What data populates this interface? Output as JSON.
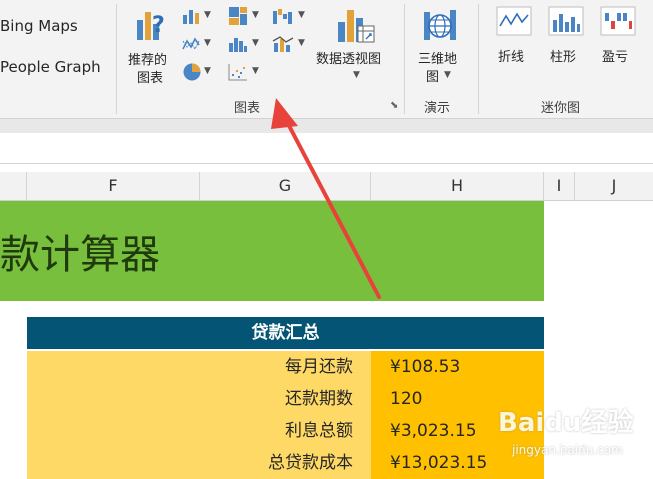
{
  "ribbon": {
    "addins": {
      "bing_maps": "Bing Maps",
      "people_graph": "People Graph"
    },
    "charts": {
      "recommended_line1": "推荐的",
      "recommended_line2": "图表",
      "pivot_chart": "数据透视图",
      "group_label": "图表"
    },
    "tours": {
      "map3d_line1": "三维地",
      "map3d_line2": "图",
      "group_label": "演示"
    },
    "sparklines": {
      "line": "折线",
      "column": "柱形",
      "winloss": "盈亏",
      "group_label": "迷你图"
    }
  },
  "sheet": {
    "columns": [
      "F",
      "G",
      "H",
      "I",
      "J"
    ],
    "title": "款计算器",
    "summary": {
      "header": "贷款汇总",
      "rows": [
        {
          "label": "每月还款",
          "value": "¥108.53"
        },
        {
          "label": "还款期数",
          "value": "120"
        },
        {
          "label": "利息总额",
          "value": "¥3,023.15"
        },
        {
          "label": "总贷款成本",
          "value": "¥13,023.15"
        }
      ]
    }
  },
  "watermark": {
    "logo": "Baidu经验",
    "url": "jingyan.baidu.com"
  },
  "colors": {
    "title_band": "#78bf3d",
    "table_header": "#045475",
    "label_cell": "#ffd966",
    "value_cell": "#ffc000",
    "arrow": "#e8433b"
  }
}
